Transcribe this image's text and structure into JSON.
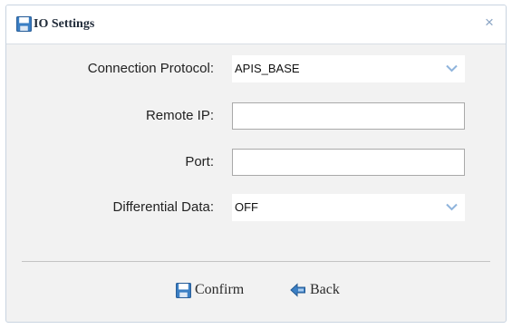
{
  "dialog": {
    "title": "IO Settings",
    "close_label": "×"
  },
  "form": {
    "protocol": {
      "label": "Connection Protocol:",
      "value": "APIS_BASE"
    },
    "remote_ip": {
      "label": "Remote IP:",
      "value": ""
    },
    "port": {
      "label": "Port:",
      "value": ""
    },
    "differential": {
      "label": "Differential Data:",
      "value": "OFF"
    }
  },
  "footer": {
    "confirm_label": "Confirm",
    "back_label": "Back"
  },
  "icons": {
    "title": "save-icon",
    "close": "close-icon",
    "dropdown": "chevron-down-icon",
    "confirm": "save-icon",
    "back": "back-arrow-icon"
  },
  "colors": {
    "panel_background": "#f2f2f2",
    "icon_blue": "#3b7fc4",
    "chevron": "#8fb4dc"
  }
}
